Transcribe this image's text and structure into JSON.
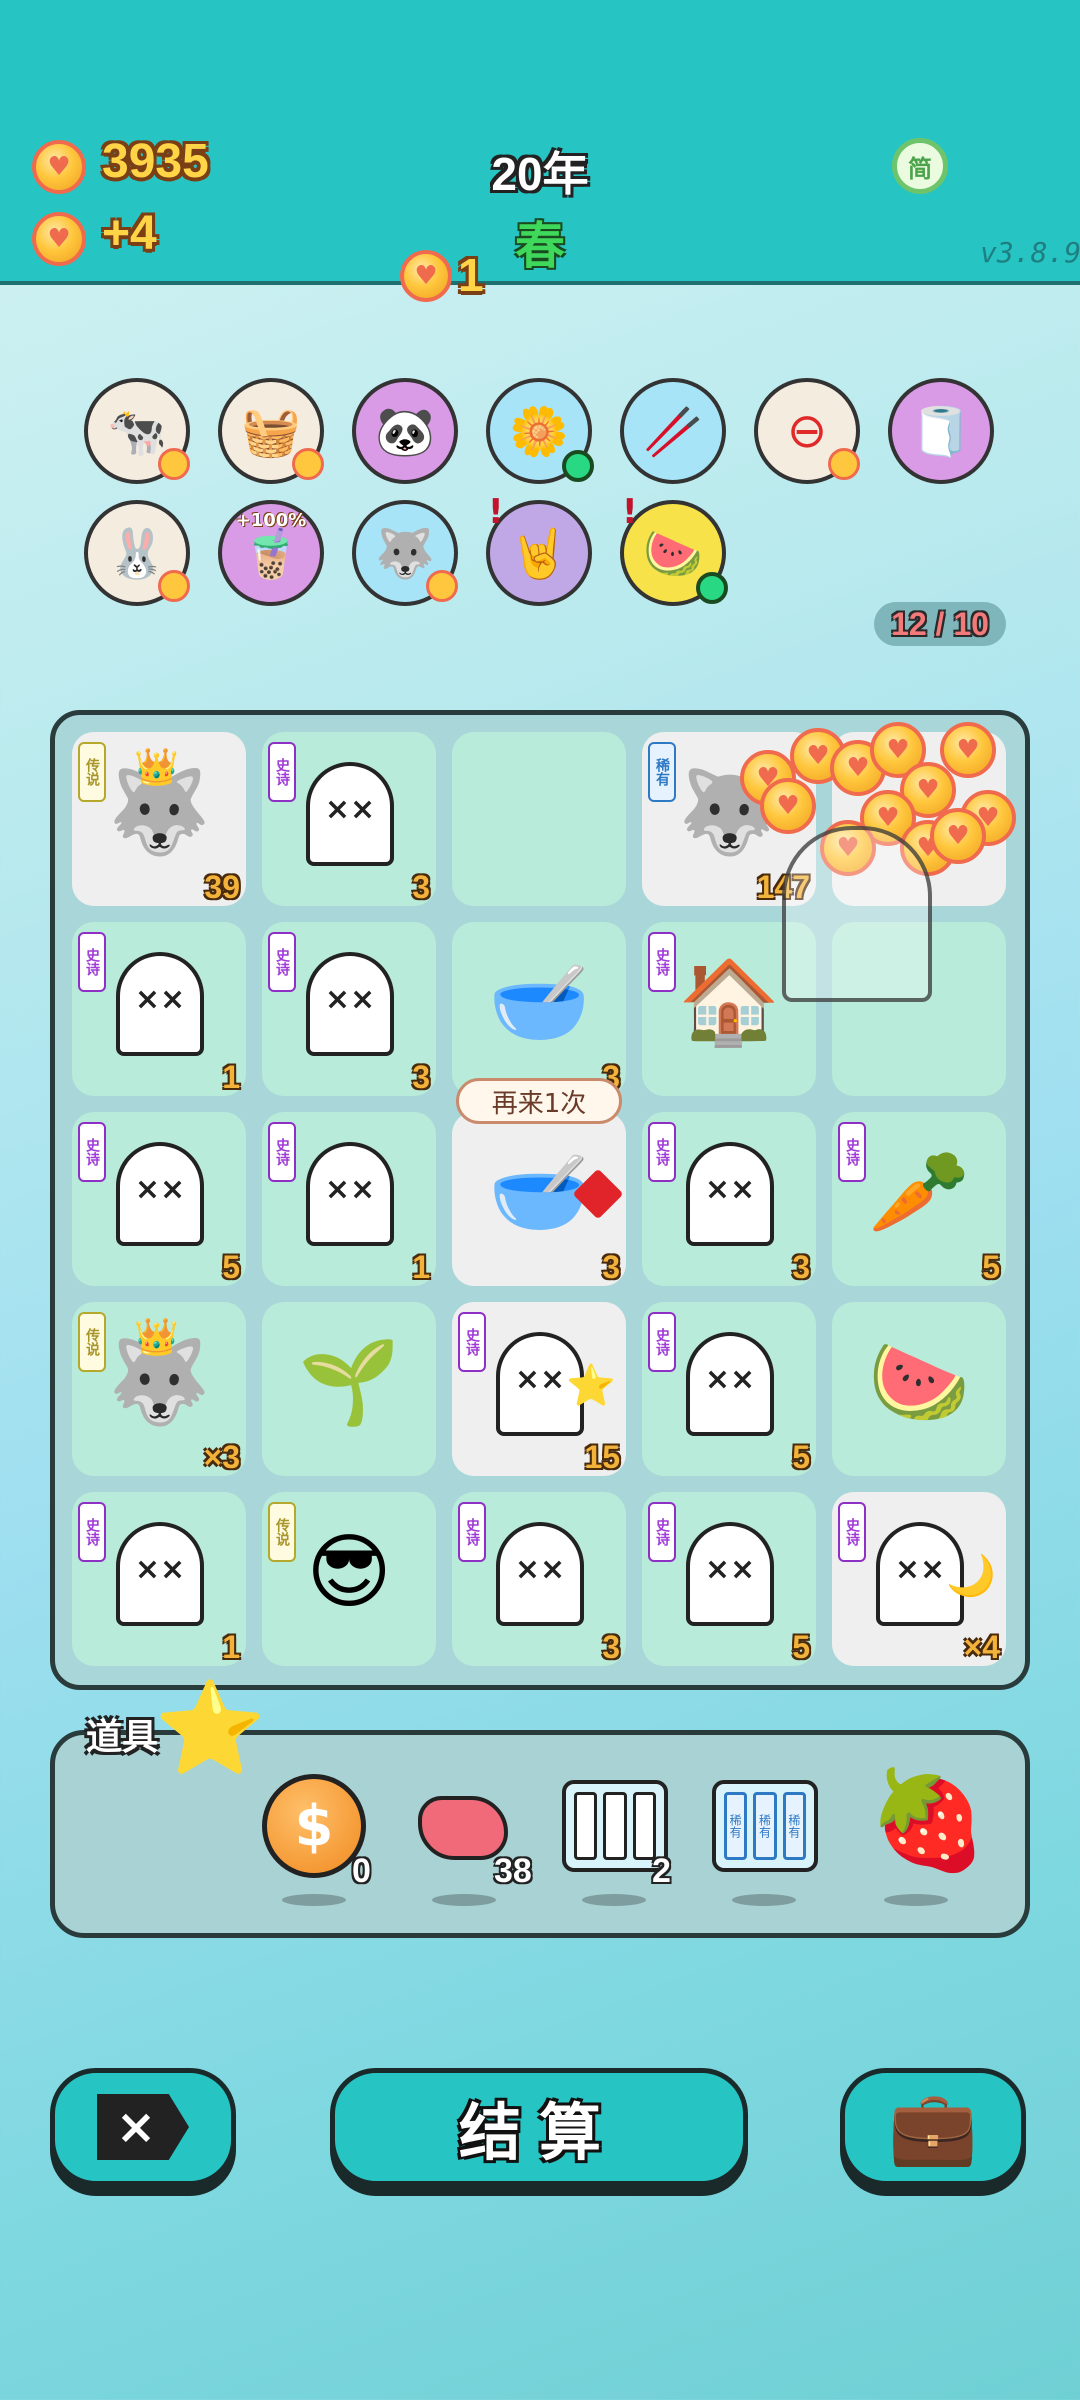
{
  "header": {
    "coins": "3935",
    "income": "+4",
    "year": "20年",
    "season": "春",
    "coin_counter": "1",
    "lang_button": "简",
    "version": "v3.8.9"
  },
  "buffs": {
    "count": "12 / 10",
    "items": [
      "cow-pair",
      "fruit-basket",
      "panda",
      "flower-pot",
      "chopsticks",
      "minus-sign",
      "tissue-box",
      "rabbit",
      "bubble-tea",
      "husky",
      "rock-hand",
      "fruit-plate"
    ],
    "bubble_tea_label": "+100%"
  },
  "board": {
    "tooltip": "再来1次",
    "cells": [
      {
        "tag": "传说",
        "num": "39",
        "icon": "crowned-husky"
      },
      {
        "tag": "史诗",
        "num": "3",
        "icon": "ghost"
      },
      {
        "tag": "",
        "num": "",
        "icon": "empty"
      },
      {
        "tag": "稀有",
        "num": "147",
        "icon": "husky"
      },
      {
        "tag": "",
        "num": "",
        "icon": "empty"
      },
      {
        "tag": "史诗",
        "num": "1",
        "icon": "ghost"
      },
      {
        "tag": "史诗",
        "num": "3",
        "icon": "ghost"
      },
      {
        "tag": "",
        "num": "3",
        "icon": "soup-bowl"
      },
      {
        "tag": "史诗",
        "num": "",
        "icon": "rabbit-house"
      },
      {
        "tag": "",
        "num": "",
        "icon": "empty"
      },
      {
        "tag": "史诗",
        "num": "5",
        "icon": "ghost"
      },
      {
        "tag": "史诗",
        "num": "1",
        "icon": "ghost"
      },
      {
        "tag": "",
        "num": "3",
        "icon": "soup-bowl-fu"
      },
      {
        "tag": "史诗",
        "num": "3",
        "icon": "ghost"
      },
      {
        "tag": "史诗",
        "num": "5",
        "icon": "carrot"
      },
      {
        "tag": "传说",
        "num": "×3",
        "icon": "crowned-husky"
      },
      {
        "tag": "",
        "num": "",
        "icon": "sprout"
      },
      {
        "tag": "史诗",
        "num": "15",
        "icon": "ghost-star"
      },
      {
        "tag": "史诗",
        "num": "5",
        "icon": "ghost"
      },
      {
        "tag": "",
        "num": "",
        "icon": "watermelon"
      },
      {
        "tag": "史诗",
        "num": "1",
        "icon": "ghost"
      },
      {
        "tag": "传说",
        "num": "",
        "icon": "sunglasses-man"
      },
      {
        "tag": "史诗",
        "num": "3",
        "icon": "ghost"
      },
      {
        "tag": "史诗",
        "num": "5",
        "icon": "ghost"
      },
      {
        "tag": "史诗",
        "num": "×4",
        "icon": "ghost-moon"
      }
    ]
  },
  "items_panel": {
    "title": "道具",
    "items": [
      {
        "icon": "dollar-coin",
        "count": "0"
      },
      {
        "icon": "liver",
        "count": "38"
      },
      {
        "icon": "triple-slot",
        "count": "2"
      },
      {
        "icon": "rare-slots",
        "count": "",
        "label": "稀有"
      },
      {
        "icon": "strawberry",
        "count": ""
      }
    ]
  },
  "footer": {
    "settle": "结算"
  },
  "colors": {
    "header": "#27c4c4",
    "coin": "#ffc73d",
    "epic": "#a03bd7",
    "legendary": "#a8962a",
    "rare": "#2e79c4"
  }
}
